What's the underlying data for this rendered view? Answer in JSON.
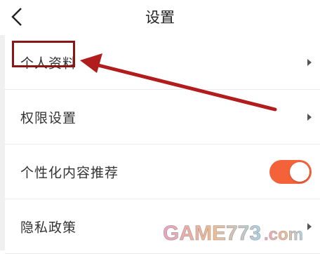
{
  "header": {
    "title": "设置",
    "back_icon": "chevron-left-icon"
  },
  "settings": {
    "items": [
      {
        "label": "个人资料",
        "control": "arrow"
      },
      {
        "label": "权限设置",
        "control": "arrow"
      },
      {
        "label": "个性化内容推荐",
        "control": "toggle",
        "toggle_on": true
      },
      {
        "label": "隐私政策",
        "control": "arrow"
      }
    ]
  },
  "annotation": {
    "highlight_color": "#8b1616",
    "arrow_color": "#b11d1d"
  },
  "watermark": {
    "text": "GAME773.com"
  },
  "colors": {
    "toggle_on": "#f4623a",
    "background": "#ffffff",
    "divider": "#ececec"
  }
}
